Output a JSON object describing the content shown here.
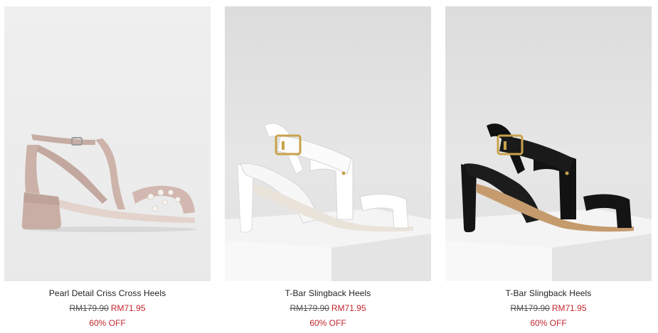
{
  "currency_note": "",
  "products": [
    {
      "name": "Pearl Detail Criss Cross Heels",
      "original_price": "RM179.90",
      "sale_price": "RM71.95",
      "discount": "60% OFF",
      "image_icon": "nude-pearl-heel-sandal",
      "color": "#c9b2aa"
    },
    {
      "name": "T-Bar Slingback Heels",
      "original_price": "RM179.90",
      "sale_price": "RM71.95",
      "discount": "60% OFF",
      "image_icon": "white-tbar-heel-sandal",
      "color": "#f5f5f3"
    },
    {
      "name": "T-Bar Slingback Heels",
      "original_price": "RM179.90",
      "sale_price": "RM71.95",
      "discount": "60% OFF",
      "image_icon": "black-tbar-heel-sandal",
      "color": "#141414"
    }
  ],
  "colors": {
    "sale": "#c4262e",
    "text": "#222222",
    "strike": "#555555"
  }
}
